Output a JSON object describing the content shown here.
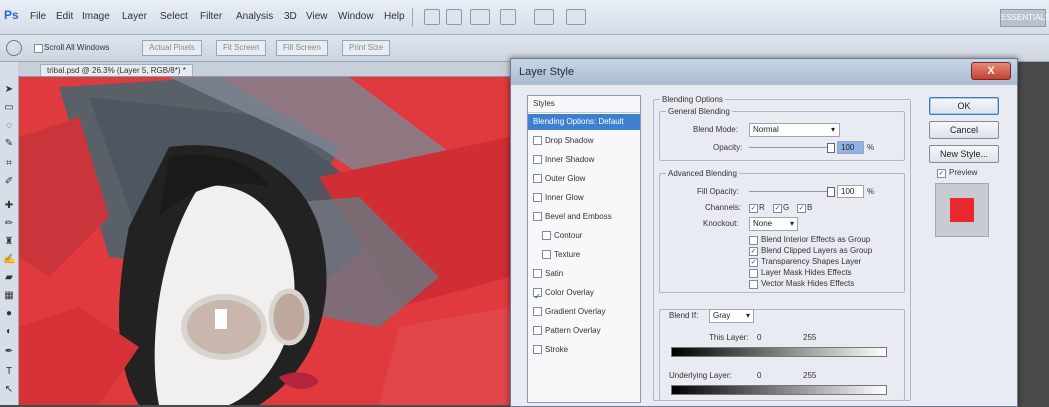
{
  "app": {
    "logo": "Ps"
  },
  "menu": [
    "File",
    "Edit",
    "Image",
    "Layer",
    "Select",
    "Filter",
    "Analysis",
    "3D",
    "View",
    "Window",
    "Help"
  ],
  "workspace_button": "ESSENTIALS",
  "options_bar": {
    "scroll_all_windows": "Scroll All Windows",
    "buttons": [
      "Actual Pixels",
      "Fit Screen",
      "Fill Screen",
      "Print Size"
    ]
  },
  "document_tab": "tribal.psd @ 26.3% (Layer 5, RGB/8*) *",
  "dialog": {
    "title": "Layer Style",
    "close_label": "X",
    "styles_header": "Styles",
    "styles": [
      {
        "label": "Blending Options: Default",
        "selected": true
      },
      {
        "label": "Drop Shadow"
      },
      {
        "label": "Inner Shadow"
      },
      {
        "label": "Outer Glow"
      },
      {
        "label": "Inner Glow"
      },
      {
        "label": "Bevel and Emboss"
      },
      {
        "label": "Contour",
        "indent": true
      },
      {
        "label": "Texture",
        "indent": true
      },
      {
        "label": "Satin"
      },
      {
        "label": "Color Overlay",
        "checked": true
      },
      {
        "label": "Gradient Overlay"
      },
      {
        "label": "Pattern Overlay"
      },
      {
        "label": "Stroke"
      }
    ],
    "blending_options_title": "Blending Options",
    "general_blending": {
      "legend": "General Blending",
      "blend_mode_label": "Blend Mode:",
      "blend_mode_value": "Normal",
      "opacity_label": "Opacity:",
      "opacity_value": "100",
      "opacity_unit": "%"
    },
    "advanced_blending": {
      "legend": "Advanced Blending",
      "fill_opacity_label": "Fill Opacity:",
      "fill_opacity_value": "100",
      "fill_opacity_unit": "%",
      "channels_label": "Channels:",
      "channels": [
        "R",
        "G",
        "B"
      ],
      "knockout_label": "Knockout:",
      "knockout_value": "None",
      "options": [
        {
          "label": "Blend Interior Effects as Group",
          "checked": false
        },
        {
          "label": "Blend Clipped Layers as Group",
          "checked": true
        },
        {
          "label": "Transparency Shapes Layer",
          "checked": true
        },
        {
          "label": "Layer Mask Hides Effects",
          "checked": false
        },
        {
          "label": "Vector Mask Hides Effects",
          "checked": false
        }
      ]
    },
    "blend_if": {
      "label": "Blend If:",
      "value": "Gray",
      "this_layer_label": "This Layer:",
      "this_layer_min": "0",
      "this_layer_max": "255",
      "underlying_label": "Underlying Layer:",
      "underlying_min": "0",
      "underlying_max": "255"
    },
    "buttons": {
      "ok": "OK",
      "cancel": "Cancel",
      "new_style": "New Style..."
    },
    "preview_label": "Preview",
    "preview_color": "#e8282e"
  },
  "colors": {
    "accent": "#3e7fd0",
    "canvas_red": "#e03a3f"
  }
}
